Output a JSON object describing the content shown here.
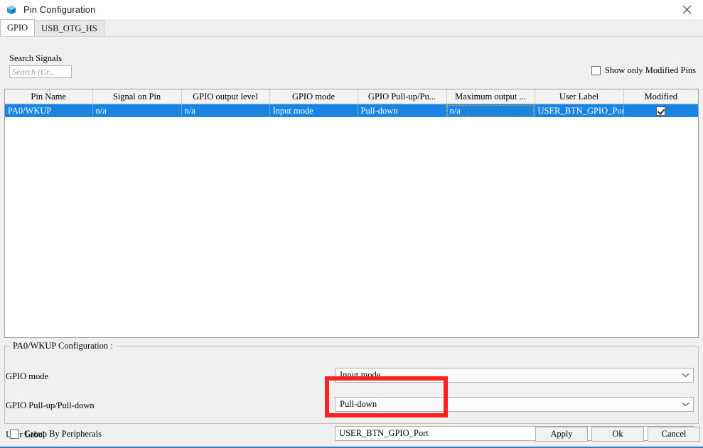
{
  "window": {
    "title": "Pin Configuration",
    "icon": "cube-icon",
    "close_label": "✕",
    "accent_color": "#2a7fd4"
  },
  "tabs": [
    {
      "label": "GPIO",
      "active": true
    },
    {
      "label": "USB_OTG_HS",
      "active": false
    }
  ],
  "search": {
    "label": "Search Signals",
    "value": "",
    "placeholder": "Search (Cr..."
  },
  "filters": {
    "show_only_modified_label": "Show only Modified Pins",
    "show_only_modified_checked": false
  },
  "table": {
    "columns": [
      {
        "label": "Pin Name",
        "sorted": true,
        "sort_mark": "˄"
      },
      {
        "label": "Signal on Pin",
        "sorted": false
      },
      {
        "label": "GPIO output level",
        "sorted": false
      },
      {
        "label": "GPIO mode",
        "sorted": false
      },
      {
        "label": "GPIO Pull-up/Pu...",
        "sorted": false
      },
      {
        "label": "Maximum output ...",
        "sorted": false
      },
      {
        "label": "User Label",
        "sorted": false
      },
      {
        "label": "Modified",
        "sorted": false
      }
    ],
    "rows": [
      {
        "selected": true,
        "pin_name": "PA0/WKUP",
        "signal_on_pin": "n/a",
        "gpio_output_level": "n/a",
        "gpio_mode": "Input mode",
        "gpio_pull": "Pull-down",
        "max_output": "n/a",
        "user_label": "USER_BTN_GPIO_Port",
        "modified": true,
        "focus_cell": "max_output"
      }
    ]
  },
  "config": {
    "group_title": "PA0/WKUP Configuration :",
    "fields": [
      {
        "label": "GPIO mode",
        "type": "combo",
        "value": "Input mode"
      },
      {
        "label": "GPIO Pull-up/Pull-down",
        "type": "combo",
        "value": "Pull-down"
      },
      {
        "label": "User Label",
        "type": "text",
        "value": "USER_BTN_GPIO_Port"
      }
    ]
  },
  "annotation": {
    "color": "#ff2020",
    "target": "user-label-field"
  },
  "footer": {
    "group_by_peripherals_label": "Group By Peripherals",
    "group_by_peripherals_checked": false,
    "buttons": [
      {
        "label": "Apply",
        "name": "apply-button"
      },
      {
        "label": "Ok",
        "name": "ok-button"
      },
      {
        "label": "Cancel",
        "name": "cancel-button"
      }
    ]
  }
}
